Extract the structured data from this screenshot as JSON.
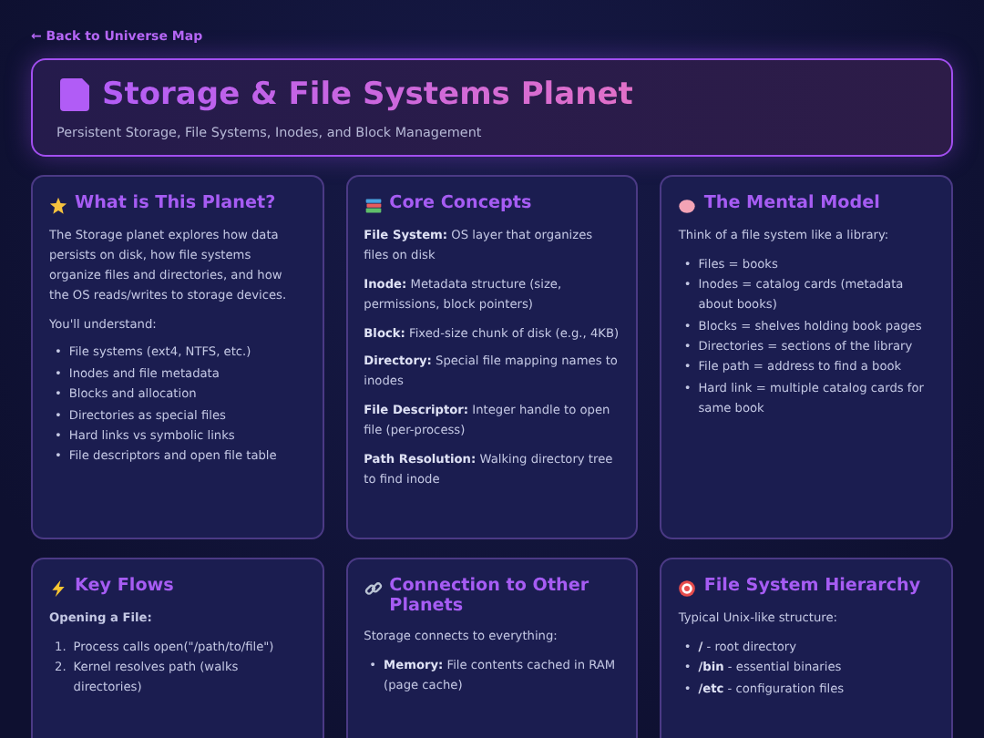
{
  "back_link": "← Back to Universe Map",
  "header": {
    "title": "Storage & File Systems Planet",
    "subtitle": "Persistent Storage, File Systems, Inodes, and Block Management"
  },
  "cards": [
    {
      "title": "What is This Planet?",
      "blocks": [
        {
          "kind": "paragraph",
          "text": "The Storage planet explores how data persists on disk, how file systems organize files and directories, and how the OS reads/writes to storage devices."
        },
        {
          "kind": "paragraph",
          "text": "You'll understand:"
        },
        {
          "kind": "list",
          "items": [
            {
              "marker": "•",
              "text": "File systems (ext4, NTFS, etc.)"
            },
            {
              "marker": "•",
              "text": "Inodes and file metadata"
            },
            {
              "marker": "•",
              "text": "Blocks and allocation"
            },
            {
              "marker": "•",
              "text": "Directories as special files"
            },
            {
              "marker": "•",
              "text": "Hard links vs symbolic links"
            },
            {
              "marker": "•",
              "text": "File descriptors and open file table"
            }
          ]
        }
      ]
    },
    {
      "title": "Core Concepts",
      "blocks": [
        {
          "kind": "paragraph",
          "text": "**File System:** OS layer that organizes files on disk"
        },
        {
          "kind": "paragraph",
          "text": "**Inode:** Metadata structure (size, permissions, block pointers)"
        },
        {
          "kind": "paragraph",
          "text": "**Block:** Fixed-size chunk of disk (e.g., 4KB)"
        },
        {
          "kind": "paragraph",
          "text": "**Directory:** Special file mapping names to inodes"
        },
        {
          "kind": "paragraph",
          "text": "**File Descriptor:** Integer handle to open file (per-process)"
        },
        {
          "kind": "paragraph",
          "text": "**Path Resolution:** Walking directory tree to find inode"
        }
      ]
    },
    {
      "title": "The Mental Model",
      "blocks": [
        {
          "kind": "paragraph",
          "text": "Think of a file system like a library:"
        },
        {
          "kind": "list",
          "items": [
            {
              "marker": "•",
              "text": "Files = books"
            },
            {
              "marker": "•",
              "text": "Inodes = catalog cards (metadata about books)"
            },
            {
              "marker": "•",
              "text": "Blocks = shelves holding book pages"
            },
            {
              "marker": "•",
              "text": "Directories = sections of the library"
            },
            {
              "marker": "•",
              "text": "File path = address to find a book"
            },
            {
              "marker": "•",
              "text": "Hard link = multiple catalog cards for same book"
            }
          ]
        }
      ]
    },
    {
      "title": "Key Flows",
      "blocks": [
        {
          "kind": "subheading",
          "text": "Opening a File:"
        },
        {
          "kind": "list",
          "items": [
            {
              "marker": "1.",
              "text": "Process calls open(\"/path/to/file\")"
            },
            {
              "marker": "2.",
              "text": "Kernel resolves path (walks directories)"
            }
          ]
        }
      ]
    },
    {
      "title": "Connection to Other Planets",
      "blocks": [
        {
          "kind": "paragraph",
          "text": "Storage connects to everything:"
        },
        {
          "kind": "list",
          "items": [
            {
              "marker": "•",
              "text": "**Memory:** File contents cached in RAM (page cache)"
            }
          ]
        }
      ]
    },
    {
      "title": "File System Hierarchy",
      "blocks": [
        {
          "kind": "paragraph",
          "text": "Typical Unix-like structure:"
        },
        {
          "kind": "list",
          "items": [
            {
              "marker": "•",
              "text": "**/** - root directory"
            },
            {
              "marker": "•",
              "text": "**/bin** - essential binaries"
            },
            {
              "marker": "•",
              "text": "**/etc** - configuration files"
            }
          ]
        }
      ]
    }
  ]
}
